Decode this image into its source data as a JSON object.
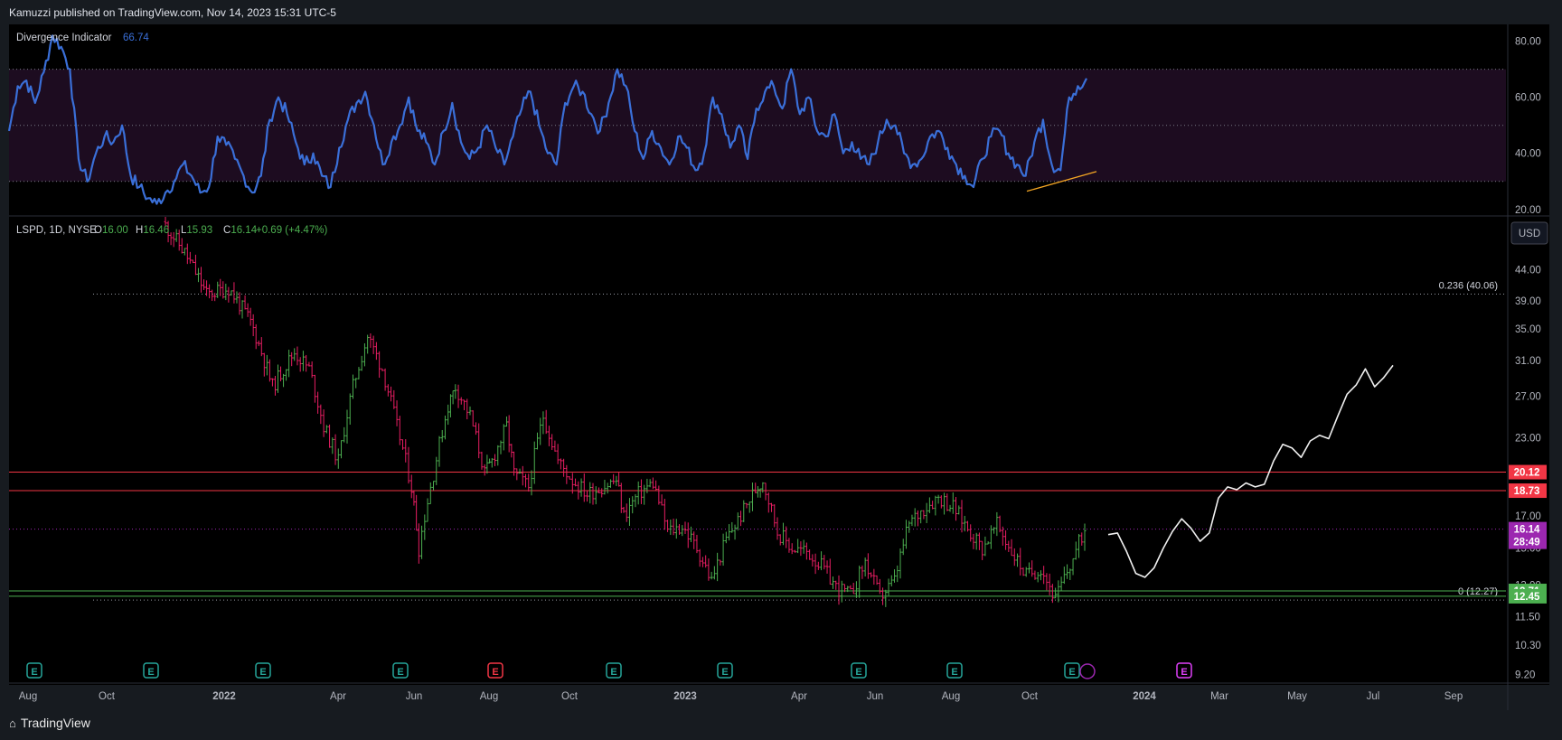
{
  "header": {
    "publisher": "Kamuzzi published on TradingView.com, Nov 14, 2023 15:31 UTC-5"
  },
  "footer": {
    "brand": "TradingView"
  },
  "chart_data": [
    {
      "type": "line",
      "name": "Divergence Indicator",
      "title": "Divergence Indicator",
      "current_value": "66.74",
      "ylim": [
        18,
        86
      ],
      "yticks": [
        "80.00",
        "60.00",
        "40.00",
        "20.00"
      ],
      "levels": [
        70,
        50,
        30
      ],
      "series_color": "#3a6fd8",
      "band_color": "#1d0c20",
      "x_key_points": [
        [
          0,
          48
        ],
        [
          1,
          64
        ],
        [
          2,
          66
        ],
        [
          3,
          58
        ],
        [
          4,
          69
        ],
        [
          5,
          82
        ],
        [
          6,
          78
        ],
        [
          7,
          70
        ],
        [
          8,
          38
        ],
        [
          9,
          30
        ],
        [
          10,
          40
        ],
        [
          11,
          46
        ],
        [
          12,
          44
        ],
        [
          13,
          50
        ],
        [
          14,
          32
        ],
        [
          15,
          28
        ],
        [
          16,
          24
        ],
        [
          17,
          22
        ],
        [
          18,
          26
        ],
        [
          19,
          30
        ],
        [
          20,
          36
        ],
        [
          21,
          32
        ],
        [
          22,
          26
        ],
        [
          23,
          28
        ],
        [
          24,
          46
        ],
        [
          25,
          43
        ],
        [
          26,
          38
        ],
        [
          27,
          32
        ],
        [
          28,
          26
        ],
        [
          29,
          32
        ],
        [
          30,
          52
        ],
        [
          31,
          60
        ],
        [
          32,
          54
        ],
        [
          33,
          44
        ],
        [
          34,
          36
        ],
        [
          35,
          40
        ],
        [
          36,
          32
        ],
        [
          37,
          28
        ],
        [
          38,
          42
        ],
        [
          39,
          52
        ],
        [
          40,
          58
        ],
        [
          41,
          62
        ],
        [
          42,
          50
        ],
        [
          43,
          36
        ],
        [
          44,
          44
        ],
        [
          45,
          50
        ],
        [
          46,
          60
        ],
        [
          47,
          48
        ],
        [
          48,
          44
        ],
        [
          49,
          36
        ],
        [
          50,
          48
        ],
        [
          51,
          58
        ],
        [
          52,
          44
        ],
        [
          53,
          38
        ],
        [
          54,
          42
        ],
        [
          55,
          50
        ],
        [
          56,
          42
        ],
        [
          57,
          36
        ],
        [
          58,
          46
        ],
        [
          59,
          56
        ],
        [
          60,
          62
        ],
        [
          61,
          50
        ],
        [
          62,
          40
        ],
        [
          63,
          36
        ],
        [
          64,
          58
        ],
        [
          65,
          64
        ],
        [
          66,
          62
        ],
        [
          67,
          54
        ],
        [
          68,
          48
        ],
        [
          69,
          58
        ],
        [
          70,
          70
        ],
        [
          71,
          64
        ],
        [
          72,
          48
        ],
        [
          73,
          38
        ],
        [
          74,
          48
        ],
        [
          75,
          42
        ],
        [
          76,
          36
        ],
        [
          77,
          46
        ],
        [
          78,
          42
        ],
        [
          79,
          34
        ],
        [
          80,
          40
        ],
        [
          81,
          60
        ],
        [
          82,
          54
        ],
        [
          83,
          42
        ],
        [
          84,
          50
        ],
        [
          85,
          38
        ],
        [
          86,
          56
        ],
        [
          87,
          62
        ],
        [
          88,
          64
        ],
        [
          89,
          56
        ],
        [
          90,
          70
        ],
        [
          91,
          54
        ],
        [
          92,
          60
        ],
        [
          93,
          48
        ],
        [
          94,
          46
        ],
        [
          95,
          54
        ],
        [
          96,
          40
        ],
        [
          97,
          44
        ],
        [
          98,
          38
        ],
        [
          99,
          36
        ],
        [
          100,
          44
        ],
        [
          101,
          52
        ],
        [
          102,
          50
        ],
        [
          103,
          40
        ],
        [
          104,
          36
        ],
        [
          105,
          38
        ],
        [
          106,
          46
        ],
        [
          107,
          48
        ],
        [
          108,
          42
        ],
        [
          109,
          36
        ],
        [
          110,
          32
        ],
        [
          111,
          28
        ],
        [
          112,
          38
        ],
        [
          113,
          46
        ],
        [
          114,
          48
        ],
        [
          115,
          40
        ],
        [
          116,
          36
        ],
        [
          117,
          32
        ],
        [
          118,
          44
        ],
        [
          119,
          52
        ],
        [
          120,
          36
        ],
        [
          121,
          34
        ],
        [
          122,
          60
        ],
        [
          123,
          64
        ],
        [
          124,
          66.74
        ]
      ],
      "x_key_range": [
        0,
        124
      ],
      "annotation": "divergence trendline"
    },
    {
      "type": "candlestick",
      "name": "LSPD",
      "legend": {
        "symbol": "LSPD, 1D, NYSE",
        "open": "O16.00",
        "high": "H16.46",
        "low": "L15.93",
        "close": "C16.14",
        "change": "+0.69 (+4.47%)"
      },
      "scale": "log",
      "ylim": [
        8.9,
        54
      ],
      "yticks": [
        "44.00",
        "39.00",
        "35.00",
        "31.00",
        "27.00",
        "23.00",
        "17.00",
        "15.00",
        "13.00",
        "11.50",
        "10.30",
        "9.20"
      ],
      "currency": "USD",
      "price_path": [
        [
          0,
          53
        ],
        [
          3,
          47
        ],
        [
          6,
          40
        ],
        [
          9,
          41
        ],
        [
          12,
          36
        ],
        [
          15,
          28
        ],
        [
          18,
          32
        ],
        [
          20,
          30
        ],
        [
          22,
          24
        ],
        [
          24,
          21
        ],
        [
          26,
          28
        ],
        [
          28,
          34
        ],
        [
          30,
          30
        ],
        [
          32,
          24
        ],
        [
          34,
          19
        ],
        [
          35,
          15
        ],
        [
          37,
          20
        ],
        [
          39,
          26
        ],
        [
          40,
          28
        ],
        [
          42,
          25
        ],
        [
          44,
          20
        ],
        [
          45,
          21
        ],
        [
          47,
          24
        ],
        [
          48,
          20
        ],
        [
          50,
          19
        ],
        [
          52,
          25
        ],
        [
          54,
          21
        ],
        [
          56,
          19.5
        ],
        [
          58,
          18.5
        ],
        [
          60,
          19
        ],
        [
          62,
          19.5
        ],
        [
          63,
          17
        ],
        [
          65,
          18.5
        ],
        [
          67,
          19.3
        ],
        [
          69,
          16
        ],
        [
          71,
          16.3
        ],
        [
          73,
          15
        ],
        [
          75,
          13.2
        ],
        [
          77,
          15.5
        ],
        [
          79,
          17
        ],
        [
          81,
          18.8
        ],
        [
          82,
          19.5
        ],
        [
          84,
          16
        ],
        [
          86,
          15
        ],
        [
          88,
          14.8
        ],
        [
          90,
          14
        ],
        [
          92,
          12.9
        ],
        [
          94,
          12.5
        ],
        [
          96,
          14.2
        ],
        [
          98,
          12.4
        ],
        [
          100,
          13.2
        ],
        [
          102,
          16.5
        ],
        [
          104,
          17.5
        ],
        [
          106,
          18.3
        ],
        [
          108,
          17.6
        ],
        [
          110,
          16.2
        ],
        [
          112,
          15
        ],
        [
          114,
          16.4
        ],
        [
          116,
          14.8
        ],
        [
          118,
          13.5
        ],
        [
          120,
          13.9
        ],
        [
          122,
          12.3
        ],
        [
          124,
          14
        ],
        [
          126,
          16.14
        ]
      ],
      "x_key_range": [
        0,
        126
      ],
      "levels": [
        {
          "label": "0.236 (40.06)",
          "value": 40.06,
          "color": "#9598a1",
          "style": "dotted"
        },
        {
          "label": "0 (12.27)",
          "value": 12.27,
          "color": "#9598a1",
          "style": "dotted"
        },
        {
          "value": 20.12,
          "color": "#f23645",
          "style": "solid",
          "badge": "20.12"
        },
        {
          "value": 18.73,
          "color": "#f23645",
          "style": "solid",
          "badge": "18.73"
        },
        {
          "value": 16.14,
          "color": "#9c27b0",
          "style": "dotted",
          "badge": "16.14",
          "badge2": "28:49"
        },
        {
          "value": 12.71,
          "color": "#4caf50",
          "style": "solid",
          "badge": "12.71"
        },
        {
          "value": 12.45,
          "color": "#4caf50",
          "style": "solid",
          "badge": "12.45"
        }
      ],
      "projection": [
        [
          0,
          15.8
        ],
        [
          1,
          15.9
        ],
        [
          2,
          14.8
        ],
        [
          3,
          13.6
        ],
        [
          4,
          13.4
        ],
        [
          5,
          13.9
        ],
        [
          6,
          15
        ],
        [
          7,
          16
        ],
        [
          8,
          16.8
        ],
        [
          9,
          16.2
        ],
        [
          10,
          15.4
        ],
        [
          11,
          15.9
        ],
        [
          12,
          18.2
        ],
        [
          13,
          19
        ],
        [
          14,
          18.8
        ],
        [
          15,
          19.3
        ],
        [
          16,
          19
        ],
        [
          17,
          19.2
        ],
        [
          18,
          21
        ],
        [
          19,
          22.4
        ],
        [
          20,
          22.1
        ],
        [
          21,
          21.3
        ],
        [
          22,
          22.7
        ],
        [
          23,
          23.2
        ],
        [
          24,
          22.9
        ],
        [
          25,
          25
        ],
        [
          26,
          27.2
        ],
        [
          27,
          28.2
        ],
        [
          28,
          30
        ],
        [
          29,
          28
        ],
        [
          30,
          29
        ],
        [
          31,
          30.4
        ]
      ],
      "x_labels": [
        "Aug",
        "Oct",
        "2022",
        "Apr",
        "Jun",
        "Aug",
        "Oct",
        "2023",
        "Apr",
        "Jun",
        "Aug",
        "Oct",
        "2024",
        "Mar",
        "May",
        "Jul",
        "Sep"
      ],
      "earnings_markers": [
        "E",
        "E",
        "E",
        "E",
        "E",
        "E",
        "E",
        "E",
        "E",
        "E",
        "E"
      ]
    }
  ]
}
